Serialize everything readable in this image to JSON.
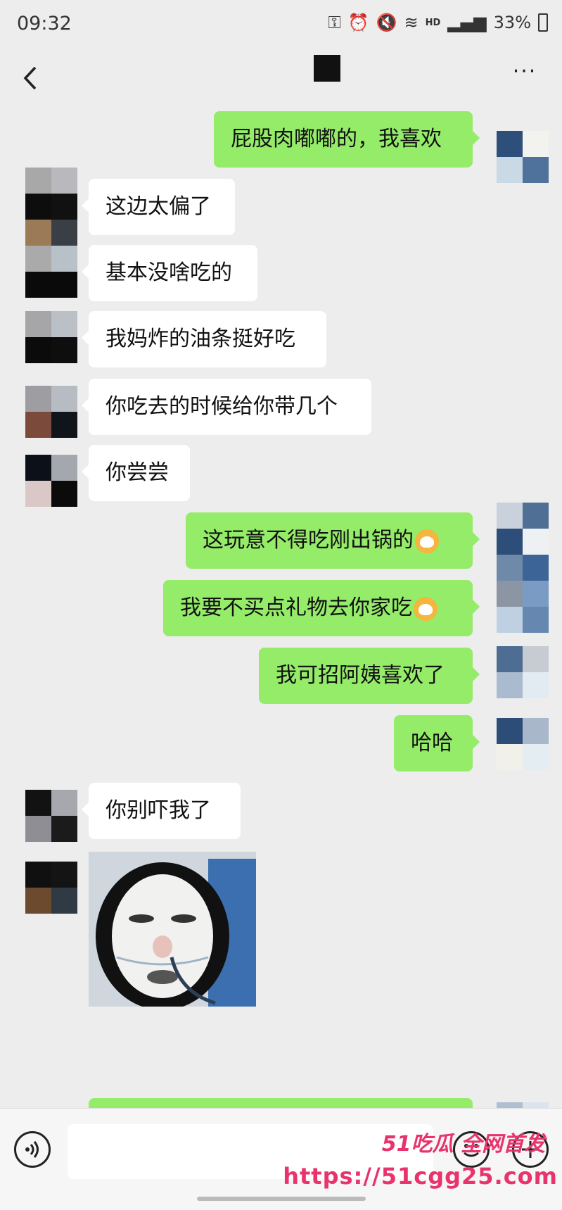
{
  "status_bar": {
    "time": "09:32",
    "network": "HD",
    "battery": "33%"
  },
  "nav": {
    "back_icon": "chevron-left-icon",
    "more_icon": "more-dots-icon",
    "more_label": "···"
  },
  "messages": [
    {
      "dir": "out",
      "text": "屁股肉嘟嘟的，我喜欢"
    },
    {
      "dir": "in",
      "text": "这边太偏了"
    },
    {
      "dir": "in",
      "text": "基本没啥吃的"
    },
    {
      "dir": "in",
      "text": "我妈炸的油条挺好吃"
    },
    {
      "dir": "in",
      "text": "你吃去的时候给你带几个"
    },
    {
      "dir": "in",
      "text": "你尝尝"
    },
    {
      "dir": "out",
      "text": "这玩意不得吃刚出锅的"
    },
    {
      "dir": "out",
      "text": "我要不买点礼物去你家吃"
    },
    {
      "dir": "out",
      "text": "我可招阿姨喜欢了"
    },
    {
      "dir": "out",
      "text": "哈哈"
    },
    {
      "dir": "in",
      "text": "你别吓我了"
    }
  ],
  "input_bar": {
    "voice_icon": "voice-icon",
    "emoji_icon": "emoji-icon",
    "plus_icon": "plus-icon"
  },
  "watermark": {
    "line1": "51吃瓜 全网首发",
    "line2": "https://51cgg25.com"
  },
  "colors": {
    "outgoing_bubble": "#95ec69",
    "incoming_bubble": "#ffffff",
    "background": "#ededed",
    "watermark": "#e8336d"
  }
}
